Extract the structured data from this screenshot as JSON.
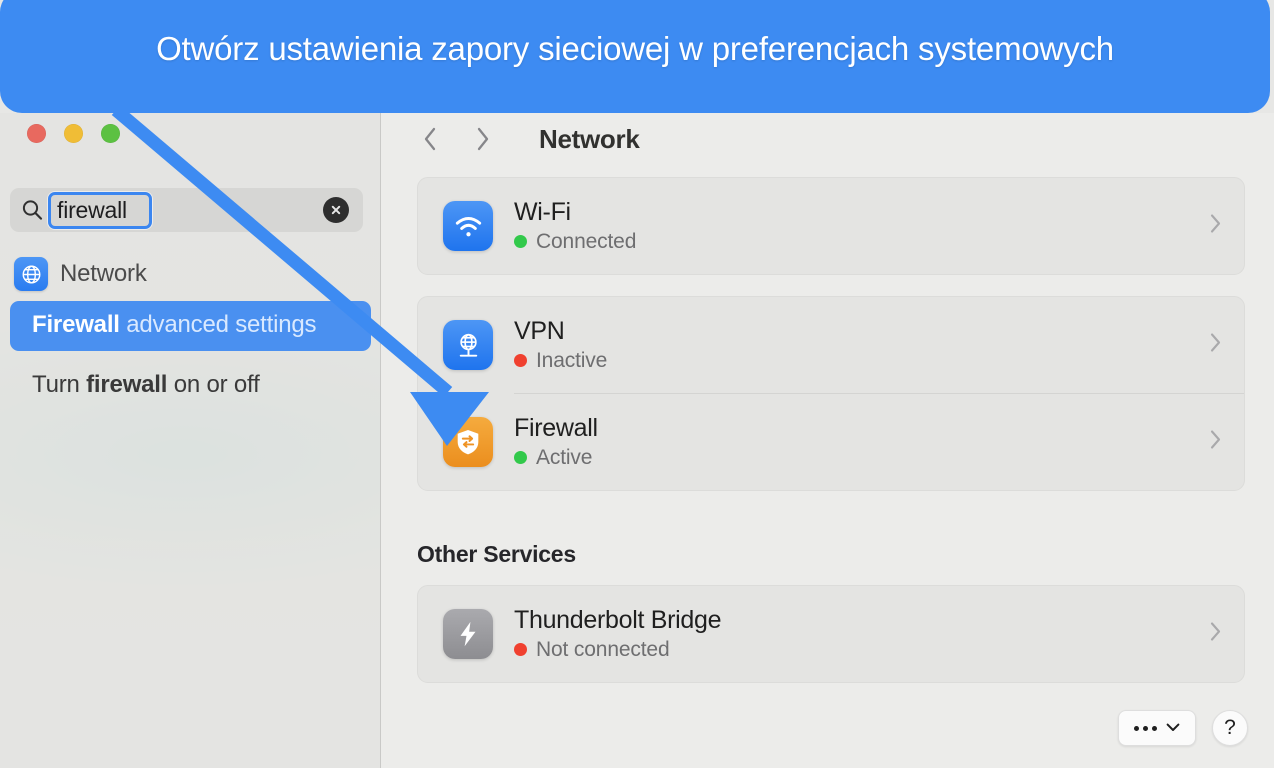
{
  "annotation": {
    "callout_text": "Otwórz ustawienia zapory sieciowej w preferencjach systemowych",
    "accent_color": "#3d8bf2",
    "arrow_target": "firewall-service-row"
  },
  "window": {
    "traffic_lights": [
      {
        "name": "close",
        "color": "#e8695f"
      },
      {
        "name": "minimize",
        "color": "#f0bd36"
      },
      {
        "name": "zoom",
        "color": "#5cc142"
      }
    ]
  },
  "sidebar": {
    "search": {
      "value": "firewall",
      "placeholder": "Search",
      "icon": "search-icon",
      "clear_icon": "clear-icon",
      "focused": true
    },
    "results": [
      {
        "type": "app",
        "label": "Network",
        "icon": "globe-icon",
        "icon_color": "#2a7cf0",
        "selected": false
      },
      {
        "type": "result",
        "label_strong": "Firewall",
        "label_rest": " advanced settings",
        "selected": true
      },
      {
        "type": "result",
        "label_pre": "Turn ",
        "label_strong": "firewall",
        "label_rest": " on or off",
        "selected": false
      }
    ]
  },
  "content": {
    "toolbar": {
      "back_icon": "chevron-left-icon",
      "forward_icon": "chevron-right-icon",
      "title": "Network"
    },
    "primary_services": [
      {
        "name": "Wi-Fi",
        "status": "Connected",
        "status_color": "#32c94b",
        "icon": "wifi-icon",
        "icon_style": "blue",
        "chevron": "chevron-right-icon"
      },
      {
        "name": "VPN",
        "status": "Inactive",
        "status_color": "#f0402f",
        "icon": "vpn-globe-icon",
        "icon_style": "blue",
        "chevron": "chevron-right-icon"
      },
      {
        "name": "Firewall",
        "status": "Active",
        "status_color": "#32c94b",
        "icon": "firewall-shield-icon",
        "icon_style": "orange",
        "chevron": "chevron-right-icon"
      }
    ],
    "other_services_heading": "Other Services",
    "other_services": [
      {
        "name": "Thunderbolt Bridge",
        "status": "Not connected",
        "status_color": "#f0402f",
        "icon": "thunderbolt-icon",
        "icon_style": "gray",
        "chevron": "chevron-right-icon"
      }
    ],
    "footer": {
      "more_label": "···",
      "more_icon": "chevron-down-icon",
      "help_label": "?"
    }
  }
}
